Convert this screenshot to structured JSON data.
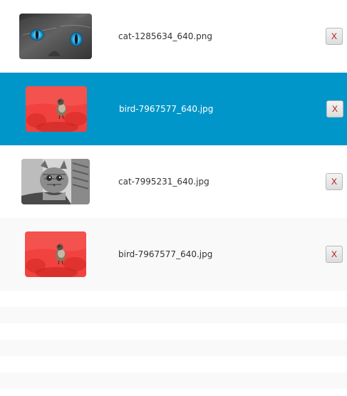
{
  "images": [
    {
      "filename": "cat-1285634_640.png",
      "remove_label": "X",
      "icon": "cat-blue-eyes-photo"
    },
    {
      "filename": "bird-7967577_640.jpg",
      "remove_label": "X",
      "icon": "bird-red-flowers-photo",
      "selected": true
    },
    {
      "filename": "cat-7995231_640.jpg",
      "remove_label": "X",
      "icon": "cat-grayscale-photo"
    },
    {
      "filename": "bird-7967577_640.jpg",
      "remove_label": "X",
      "icon": "bird-red-flowers-photo"
    }
  ],
  "colors": {
    "selection": "#0096c9",
    "stripe": "#f9f9f9",
    "remove_text": "#b01818"
  }
}
